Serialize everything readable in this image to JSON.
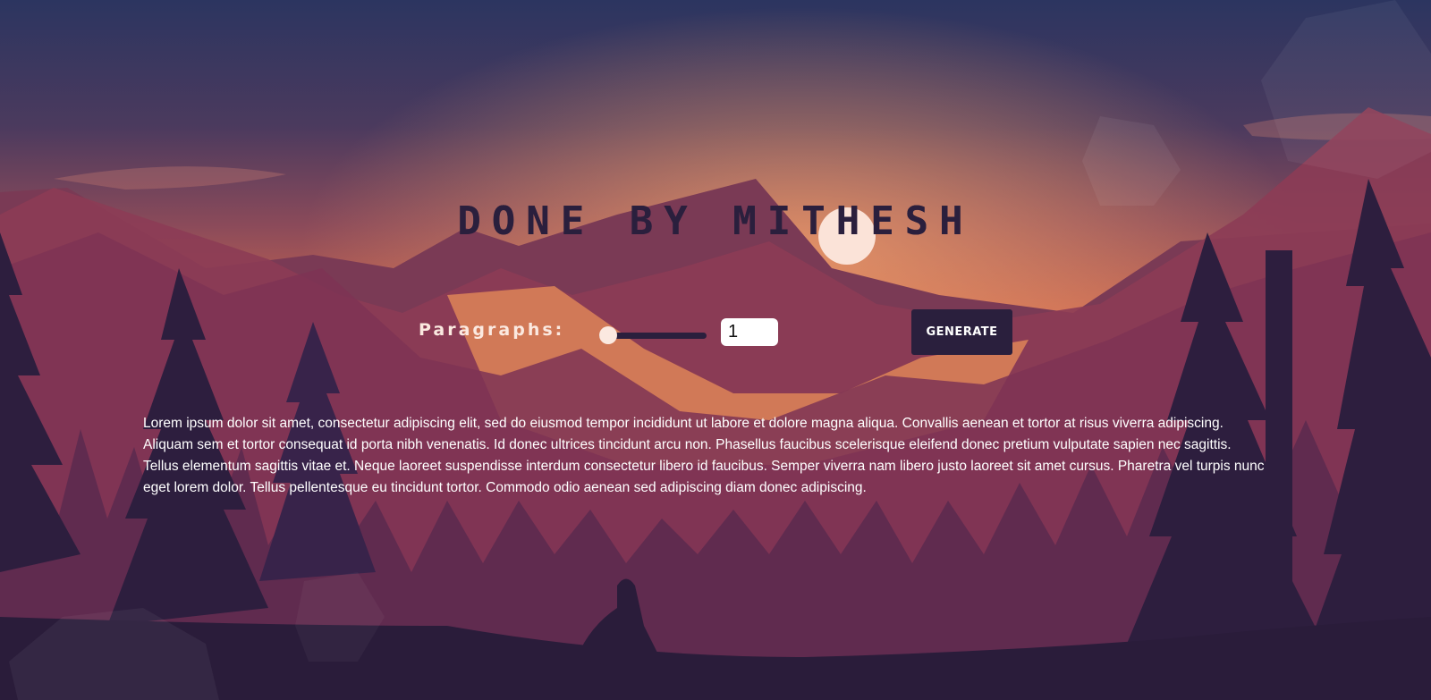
{
  "header": {
    "title": "DONE BY MITHESH"
  },
  "controls": {
    "label": "Paragraphs:",
    "slider_value": 1,
    "slider_min": 1,
    "slider_max": 10,
    "count_value": "1",
    "generate_label": "GENERATE"
  },
  "output": {
    "paragraphs": [
      "Lorem ipsum dolor sit amet, consectetur adipiscing elit, sed do eiusmod tempor incididunt ut labore et dolore magna aliqua. Convallis aenean et tortor at risus viverra adipiscing. Aliquam sem et tortor consequat id porta nibh venenatis. Id donec ultrices tincidunt arcu non. Phasellus faucibus scelerisque eleifend donec pretium vulputate sapien nec sagittis. Tellus elementum sagittis vitae et. Neque laoreet suspendisse interdum consectetur libero id faucibus. Semper viverra nam libero justo laoreet sit amet cursus. Pharetra vel turpis nunc eget lorem dolor. Tellus pellentesque eu tincidunt tortor. Commodo odio aenean sed adipiscing diam donec adipiscing."
    ]
  },
  "colors": {
    "sky_top": "#2c3560",
    "sky_glow": "#e8845a",
    "dark_purple": "#2a1f3d",
    "light_text": "#fbe9e0",
    "button_text": "#ffffff"
  }
}
